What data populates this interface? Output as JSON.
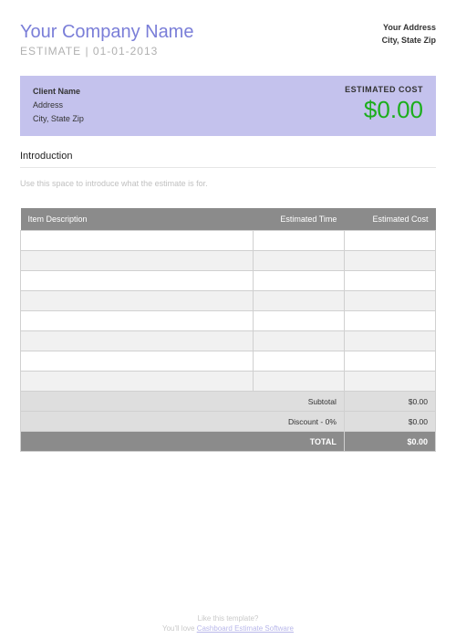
{
  "header": {
    "company_name": "Your Company Name",
    "estimate_label": "ESTIMATE",
    "estimate_date": "01-01-2013",
    "your_address_line1": "Your Address",
    "your_address_line2": "City, State Zip"
  },
  "client": {
    "name": "Client Name",
    "address_line1": "Address",
    "address_line2": "City, State Zip",
    "estimated_cost_label": "ESTIMATED COST",
    "cost_value": "$0.00"
  },
  "intro": {
    "heading": "Introduction",
    "placeholder_text": "Use this space to introduce what the estimate is for."
  },
  "table": {
    "columns": {
      "description": "Item Description",
      "time": "Estimated Time",
      "cost": "Estimated Cost"
    },
    "rows": [
      {
        "description": "",
        "time": "",
        "cost": ""
      },
      {
        "description": "",
        "time": "",
        "cost": ""
      },
      {
        "description": "",
        "time": "",
        "cost": ""
      },
      {
        "description": "",
        "time": "",
        "cost": ""
      },
      {
        "description": "",
        "time": "",
        "cost": ""
      },
      {
        "description": "",
        "time": "",
        "cost": ""
      },
      {
        "description": "",
        "time": "",
        "cost": ""
      },
      {
        "description": "",
        "time": "",
        "cost": ""
      }
    ],
    "summary": {
      "subtotal_label": "Subtotal",
      "subtotal_value": "$0.00",
      "discount_label": "Discount - 0%",
      "discount_value": "$0.00",
      "total_label": "TOTAL",
      "total_value": "$0.00"
    }
  },
  "footer": {
    "line1": "Like this template?",
    "line2_prefix": "You'll love ",
    "link_text": "Cashboard Estimate Software"
  }
}
